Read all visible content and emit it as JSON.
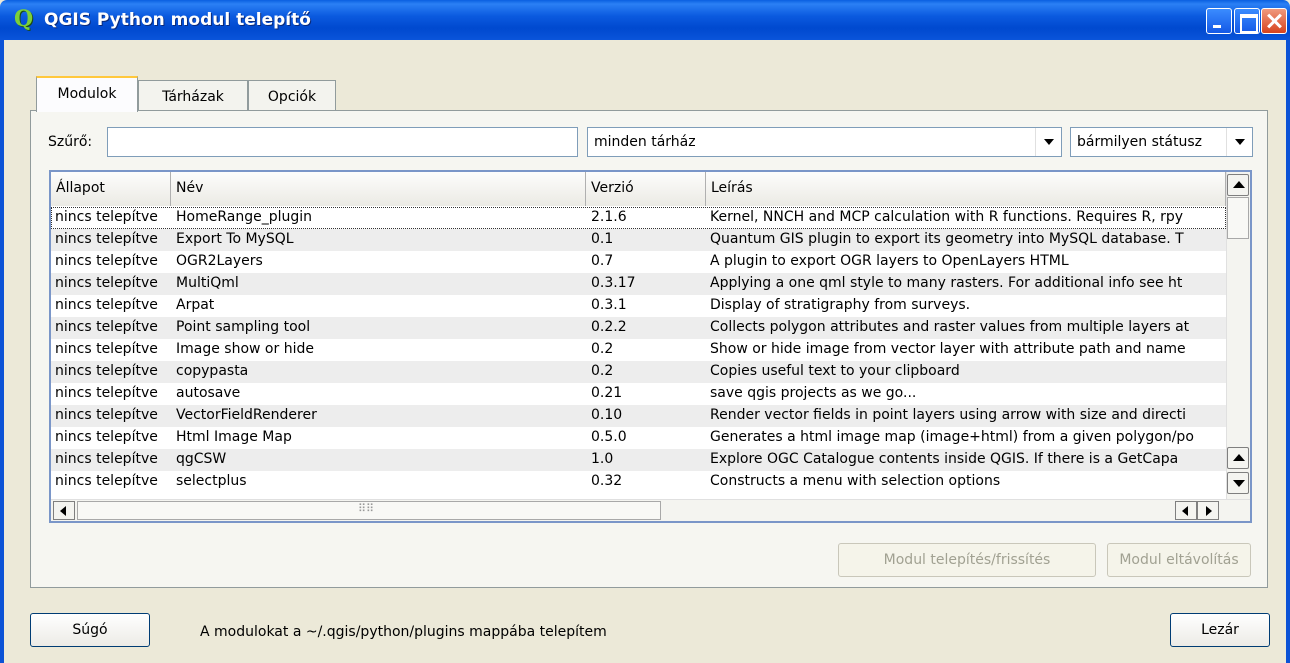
{
  "window": {
    "title": "QGIS Python modul telepítő",
    "icon": "qgis-logo-icon"
  },
  "tabs": [
    {
      "label": "Modulok",
      "active": true
    },
    {
      "label": "Tárházak",
      "active": false
    },
    {
      "label": "Opciók",
      "active": false
    }
  ],
  "filter": {
    "label": "Szűrő:",
    "value": "",
    "placeholder": ""
  },
  "repo_select": {
    "value": "minden tárház"
  },
  "status_select": {
    "value": "bármilyen státusz"
  },
  "table": {
    "headers": [
      "Állapot",
      "Név",
      "Verzió",
      "Leírás"
    ],
    "rows": [
      [
        "nincs telepítve",
        "HomeRange_plugin",
        "2.1.6",
        "Kernel, NNCH and MCP calculation with R functions. Requires R, rpy"
      ],
      [
        "nincs telepítve",
        "Export To MySQL",
        "0.1",
        "Quantum GIS plugin to export its geometry into MySQL database. T"
      ],
      [
        "nincs telepítve",
        "OGR2Layers",
        "0.7",
        "A plugin to export OGR layers to OpenLayers HTML"
      ],
      [
        "nincs telepítve",
        "MultiQml",
        "0.3.17",
        "Applying a one qml style to many rasters. For additional info see ht"
      ],
      [
        "nincs telepítve",
        "Arpat",
        "0.3.1",
        "Display of stratigraphy from surveys."
      ],
      [
        "nincs telepítve",
        "Point sampling tool",
        "0.2.2",
        "Collects polygon attributes and raster values from multiple layers at"
      ],
      [
        "nincs telepítve",
        "Image show or hide",
        "0.2",
        "Show or hide image from vector layer with attribute path and name"
      ],
      [
        "nincs telepítve",
        "copypasta",
        "0.2",
        "Copies useful text to your clipboard"
      ],
      [
        "nincs telepítve",
        "autosave",
        "0.21",
        "save qgis projects as we go..."
      ],
      [
        "nincs telepítve",
        "VectorFieldRenderer",
        "0.10",
        "Render vector fields in point layers using arrow with size and directi"
      ],
      [
        "nincs telepítve",
        "Html Image Map",
        "0.5.0",
        "Generates a html image map (image+html) from a given polygon/po"
      ],
      [
        "nincs telepítve",
        "qgCSW",
        "1.0",
        "Explore OGC Catalogue contents inside QGIS. If there is a GetCapa"
      ],
      [
        "nincs telepítve",
        "selectplus",
        "0.32",
        "Constructs a menu with selection options"
      ]
    ]
  },
  "buttons": {
    "install": "Modul telepítés/frissítés",
    "uninstall": "Modul eltávolítás",
    "help": "Súgó",
    "close": "Lezár"
  },
  "status_text": "A modulokat a ~/.qgis/python/plugins mappába telepítem"
}
